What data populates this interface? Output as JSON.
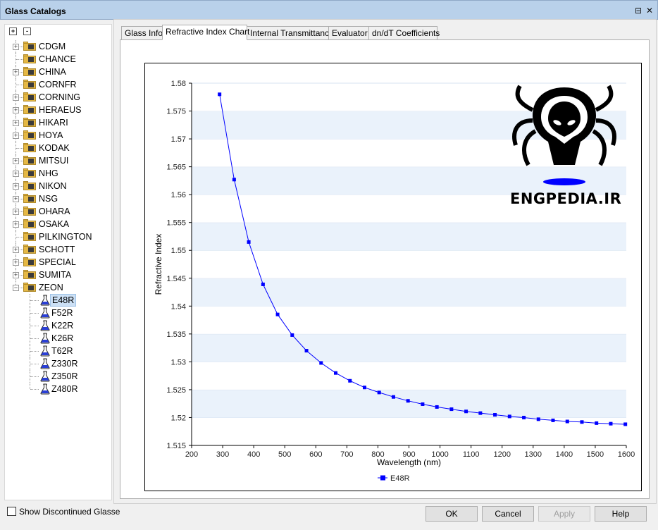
{
  "window": {
    "title": "Glass Catalogs"
  },
  "tree": {
    "expand_all": "+",
    "collapse_all": "-",
    "catalogs": [
      {
        "label": "CDGM",
        "expandable": true
      },
      {
        "label": "CHANCE",
        "expandable": false
      },
      {
        "label": "CHINA",
        "expandable": true
      },
      {
        "label": "CORNFR",
        "expandable": false
      },
      {
        "label": "CORNING",
        "expandable": true
      },
      {
        "label": "HERAEUS",
        "expandable": true
      },
      {
        "label": "HIKARI",
        "expandable": true
      },
      {
        "label": "HOYA",
        "expandable": true
      },
      {
        "label": "KODAK",
        "expandable": false
      },
      {
        "label": "MITSUI",
        "expandable": true
      },
      {
        "label": "NHG",
        "expandable": true
      },
      {
        "label": "NIKON",
        "expandable": true
      },
      {
        "label": "NSG",
        "expandable": true
      },
      {
        "label": "OHARA",
        "expandable": true
      },
      {
        "label": "OSAKA",
        "expandable": true
      },
      {
        "label": "PILKINGTON",
        "expandable": false
      },
      {
        "label": "SCHOTT",
        "expandable": true
      },
      {
        "label": "SPECIAL",
        "expandable": true
      },
      {
        "label": "SUMITA",
        "expandable": true
      },
      {
        "label": "ZEON",
        "expandable": true,
        "expanded": true
      }
    ],
    "zeon_glasses": [
      "E48R",
      "F52R",
      "K22R",
      "K26R",
      "T62R",
      "Z330R",
      "Z350R",
      "Z480R"
    ],
    "selected": "E48R"
  },
  "show_discontinued": {
    "label": "Show Discontinued Glasse",
    "checked": false
  },
  "tabs": [
    {
      "label": "Glass Info",
      "active": false
    },
    {
      "label": "Refractive Index Chart",
      "active": true
    },
    {
      "label": "Internal Transmittance",
      "active": false
    },
    {
      "label": "Evaluator",
      "active": false
    },
    {
      "label": "dn/dT Coefficients",
      "active": false
    }
  ],
  "watermark": {
    "text": "ENGPEDIA.IR"
  },
  "buttons": {
    "ok": "OK",
    "cancel": "Cancel",
    "apply": "Apply",
    "help": "Help"
  },
  "chart_data": {
    "type": "line",
    "xlabel": "Wavelength (nm)",
    "ylabel": "Refractive Index",
    "xlim": [
      200,
      1600
    ],
    "ylim": [
      1.515,
      1.58
    ],
    "xticks": [
      200,
      300,
      400,
      500,
      600,
      700,
      800,
      900,
      1000,
      1100,
      1200,
      1300,
      1400,
      1500,
      1600
    ],
    "yticks": [
      "1.515",
      "1.52",
      "1.525",
      "1.53",
      "1.535",
      "1.54",
      "1.545",
      "1.55",
      "1.555",
      "1.56",
      "1.565",
      "1.57",
      "1.575",
      "1.58"
    ],
    "legend": "bottom",
    "grid": "alternating horizontal bands",
    "series": [
      {
        "name": "E48R",
        "color": "#0000ff",
        "x": [
          290,
          337,
          384,
          430,
          477,
          524,
          570,
          617,
          664,
          710,
          757,
          804,
          850,
          897,
          944,
          990,
          1037,
          1084,
          1130,
          1177,
          1224,
          1270,
          1317,
          1364,
          1410,
          1457,
          1504,
          1550,
          1597
        ],
        "y": [
          1.578,
          1.5627,
          1.5515,
          1.5439,
          1.5385,
          1.5348,
          1.532,
          1.5298,
          1.528,
          1.5266,
          1.5254,
          1.5245,
          1.5237,
          1.523,
          1.5224,
          1.5219,
          1.5215,
          1.5211,
          1.5208,
          1.5205,
          1.5202,
          1.52,
          1.5197,
          1.5195,
          1.5193,
          1.5192,
          1.519,
          1.5189,
          1.5188
        ]
      }
    ]
  }
}
